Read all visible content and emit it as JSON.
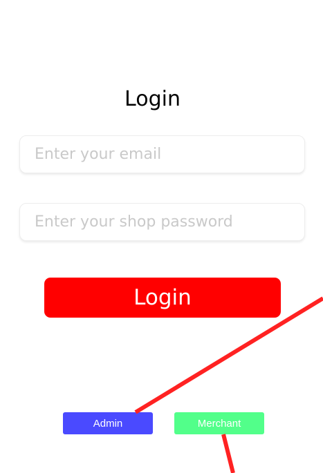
{
  "login": {
    "title": "Login",
    "email_placeholder": "Enter your email",
    "password_placeholder": "Enter your shop password",
    "submit_label": "Login"
  },
  "roles": {
    "admin_label": "Admin",
    "merchant_label": "Merchant"
  },
  "colors": {
    "login_button": "#ff0000",
    "admin_button": "#4a4aff",
    "merchant_button": "#52ff8a",
    "annotation_line": "#ff2222"
  }
}
